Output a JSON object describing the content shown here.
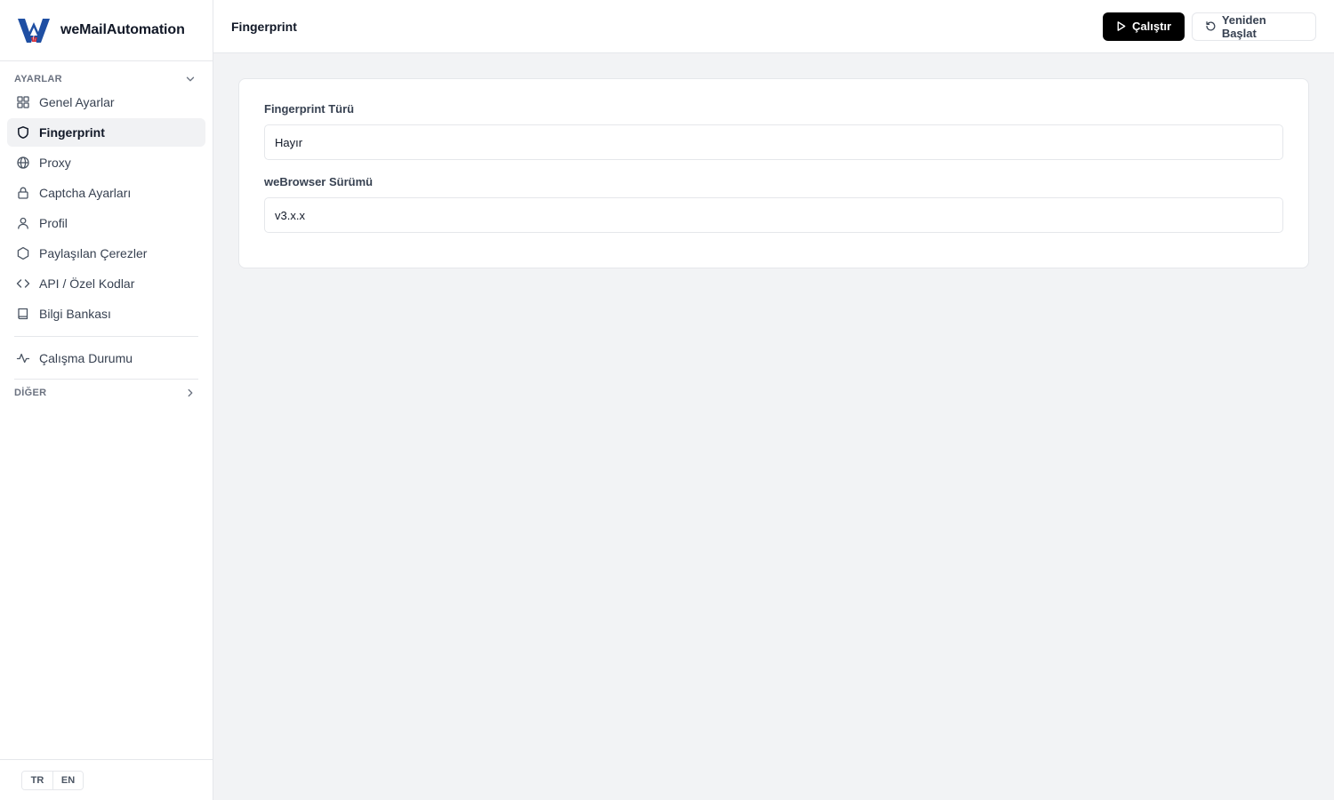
{
  "brand": {
    "name": "weMailAutomation"
  },
  "sidebar": {
    "settings_heading": "AYARLAR",
    "items": [
      {
        "label": "Genel Ayarlar",
        "icon": "grid-icon"
      },
      {
        "label": "Fingerprint",
        "icon": "shield-icon",
        "active": true
      },
      {
        "label": "Proxy",
        "icon": "globe-icon"
      },
      {
        "label": "Captcha Ayarları",
        "icon": "lock-icon"
      },
      {
        "label": "Profil",
        "icon": "user-icon"
      },
      {
        "label": "Paylaşılan Çerezler",
        "icon": "hexagon-icon"
      },
      {
        "label": "API / Özel Kodlar",
        "icon": "code-icon"
      },
      {
        "label": "Bilgi Bankası",
        "icon": "book-icon"
      }
    ],
    "status_item": {
      "label": "Çalışma Durumu",
      "icon": "activity-icon"
    },
    "other_heading": "DİĞER",
    "languages": [
      "TR",
      "EN"
    ]
  },
  "header": {
    "title": "Fingerprint",
    "run_label": "Çalıştır",
    "restart_label": "Yeniden Başlat"
  },
  "form": {
    "fingerprint_type": {
      "label": "Fingerprint Türü",
      "value": "Hayır"
    },
    "browser_version": {
      "label": "weBrowser Sürümü",
      "value": "v3.x.x"
    }
  },
  "colors": {
    "accent": "#000000",
    "background": "#f2f3f5",
    "active_item_bg": "#f1f2f4",
    "logo_blue": "#1f4fa3",
    "logo_red": "#d62e3a"
  }
}
